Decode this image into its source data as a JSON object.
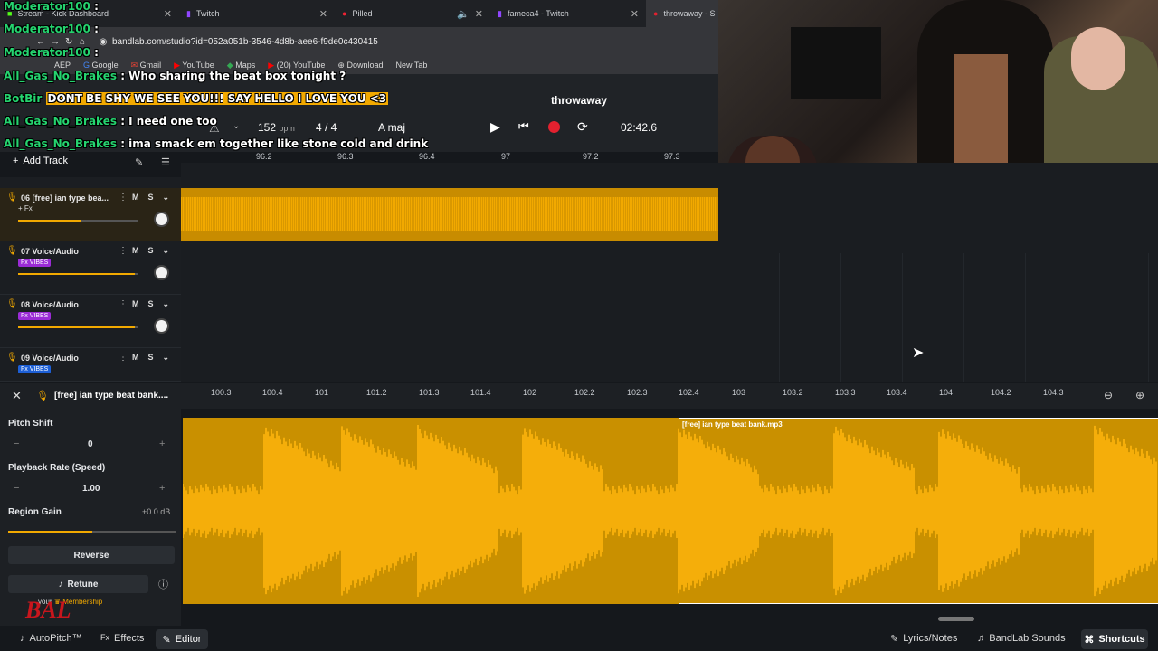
{
  "browser": {
    "tabs": [
      {
        "label": "Stream - Kick Dashboard",
        "icon": "kick-icon"
      },
      {
        "label": "Twitch",
        "icon": "twitch-icon"
      },
      {
        "label": "Pilled",
        "icon": "pilled-icon"
      },
      {
        "label": "fameca4 - Twitch",
        "icon": "twitch-icon"
      },
      {
        "label": "throwaway - S",
        "icon": "bandlab-icon"
      }
    ],
    "url": "bandlab.com/studio?id=052a051b-3546-4d8b-aee6-f9de0c430415",
    "bookmarks": [
      "AEP",
      "Google",
      "Gmail",
      "YouTube",
      "Maps",
      "(20) YouTube",
      "Download",
      "New Tab"
    ]
  },
  "chat": [
    {
      "user": "Moderator100",
      "text": ":"
    },
    {
      "user": "Moderator100",
      "text": ":"
    },
    {
      "user": "Moderator100",
      "text": ":"
    },
    {
      "user": "All_Gas_No_Brakes",
      "text": ": Who sharing the beat box tonight ?"
    },
    {
      "user": "BotBir",
      "text": "DONT BE SHY WE SEE YOU!!! SAY HELLO I LOVE YOU <3"
    },
    {
      "user": "All_Gas_No_Brakes",
      "text": ": I need one too"
    },
    {
      "user": "All_Gas_No_Brakes",
      "text": ": ima smack em together like stone cold and drink"
    }
  ],
  "project": {
    "title": "throwaway"
  },
  "transport": {
    "bpm": "152",
    "bpm_unit": "bpm",
    "time_signature": "4 / 4",
    "key": "A maj",
    "time": "02:42.6"
  },
  "toolbar": {
    "add_track": "Add Track"
  },
  "top_ruler": [
    "96.2",
    "96.3",
    "96.4",
    "97",
    "97.2",
    "97.3"
  ],
  "tracks": [
    {
      "name": "06  [free] ian type bea...",
      "fx": "+ Fx",
      "fx_style": "plain",
      "volume": 0.52
    },
    {
      "name": "07  Voice/Audio",
      "fx": "Fx VIBES",
      "fx_style": "purple",
      "volume": 0.98
    },
    {
      "name": "08  Voice/Audio",
      "fx": "Fx VIBES",
      "fx_style": "purple",
      "volume": 0.98
    },
    {
      "name": "09  Voice/Audio",
      "fx": "Fx VIBES",
      "fx_style": "blue",
      "volume": 0.98
    }
  ],
  "editor": {
    "clip_title": "[free] ian type beat bank....",
    "ruler": [
      "100.3",
      "100.4",
      "101",
      "101.2",
      "101.3",
      "101.4",
      "102",
      "102.2",
      "102.3",
      "102.4",
      "103",
      "103.2",
      "103.3",
      "103.4",
      "104",
      "104.2",
      "104.3"
    ],
    "region_label": "[free] ian type beat bank.mp3",
    "pitch_shift_label": "Pitch Shift",
    "pitch_shift_value": "0",
    "playback_rate_label": "Playback Rate (Speed)",
    "playback_rate_value": "1.00",
    "region_gain_label": "Region Gain",
    "region_gain_value": "+0.0 dB",
    "region_gain_level": 0.5,
    "reverse_label": "Reverse",
    "retune_label": "Retune",
    "membership_text": "your",
    "membership_label": "Membership"
  },
  "footer": {
    "autopitch": "AutoPitch™",
    "effects": "Effects",
    "editor": "Editor",
    "lyrics": "Lyrics/Notes",
    "sounds": "BandLab Sounds",
    "shortcuts": "Shortcuts"
  },
  "colors": {
    "accent": "#f2a900",
    "record": "#e2212f",
    "fx_purple": "#9b2bd6",
    "fx_blue": "#1d5fd6"
  }
}
